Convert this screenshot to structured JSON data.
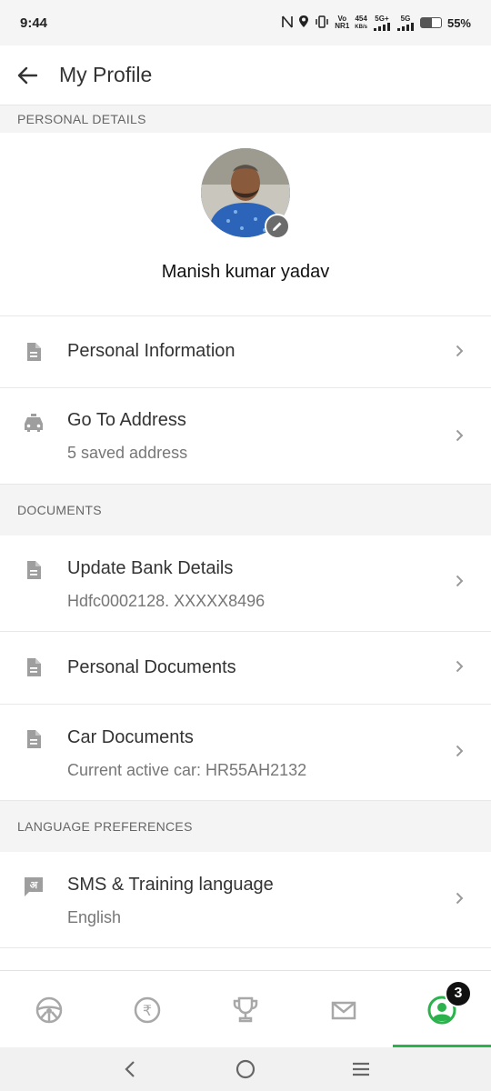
{
  "status_bar": {
    "time": "9:44",
    "network_speed_value": "454",
    "network_speed_unit": "KB/s",
    "volte": "Vo",
    "nr": "NR1",
    "sim1": "5G+",
    "sim2": "5G",
    "battery_percent": "55%"
  },
  "header": {
    "title": "My Profile",
    "back_icon": "arrow-left-icon"
  },
  "personal_details": {
    "section_label": "PERSONAL DETAILS",
    "name": "Manish kumar yadav",
    "edit_icon": "pencil-icon"
  },
  "rows_personal": [
    {
      "title": "Personal Information",
      "icon": "document-icon"
    },
    {
      "title": "Go To Address",
      "subtitle": "5 saved address",
      "icon": "car-icon"
    }
  ],
  "documents": {
    "section_label": "DOCUMENTS",
    "rows": [
      {
        "title": "Update Bank Details",
        "subtitle": "Hdfc0002128. XXXXX8496",
        "icon": "document-icon"
      },
      {
        "title": "Personal Documents",
        "icon": "document-icon"
      },
      {
        "title": "Car Documents",
        "subtitle": "Current active car: HR55AH2132",
        "icon": "document-icon"
      }
    ]
  },
  "language": {
    "section_label": "LANGUAGE PREFERENCES",
    "rows": [
      {
        "title": "SMS & Training language",
        "subtitle": "English",
        "icon": "language-chat-icon",
        "icon_glyph": "अ"
      }
    ]
  },
  "bottom_nav": {
    "items": [
      {
        "icon": "steering-wheel-icon"
      },
      {
        "icon": "rupee-icon",
        "glyph": "₹"
      },
      {
        "icon": "trophy-icon"
      },
      {
        "icon": "mail-icon"
      },
      {
        "icon": "profile-icon",
        "badge": "3",
        "active": true
      }
    ]
  },
  "colors": {
    "accent": "#2bb24c",
    "section_bg": "#f4f4f4",
    "text_primary": "#333333",
    "text_secondary": "#777777"
  }
}
